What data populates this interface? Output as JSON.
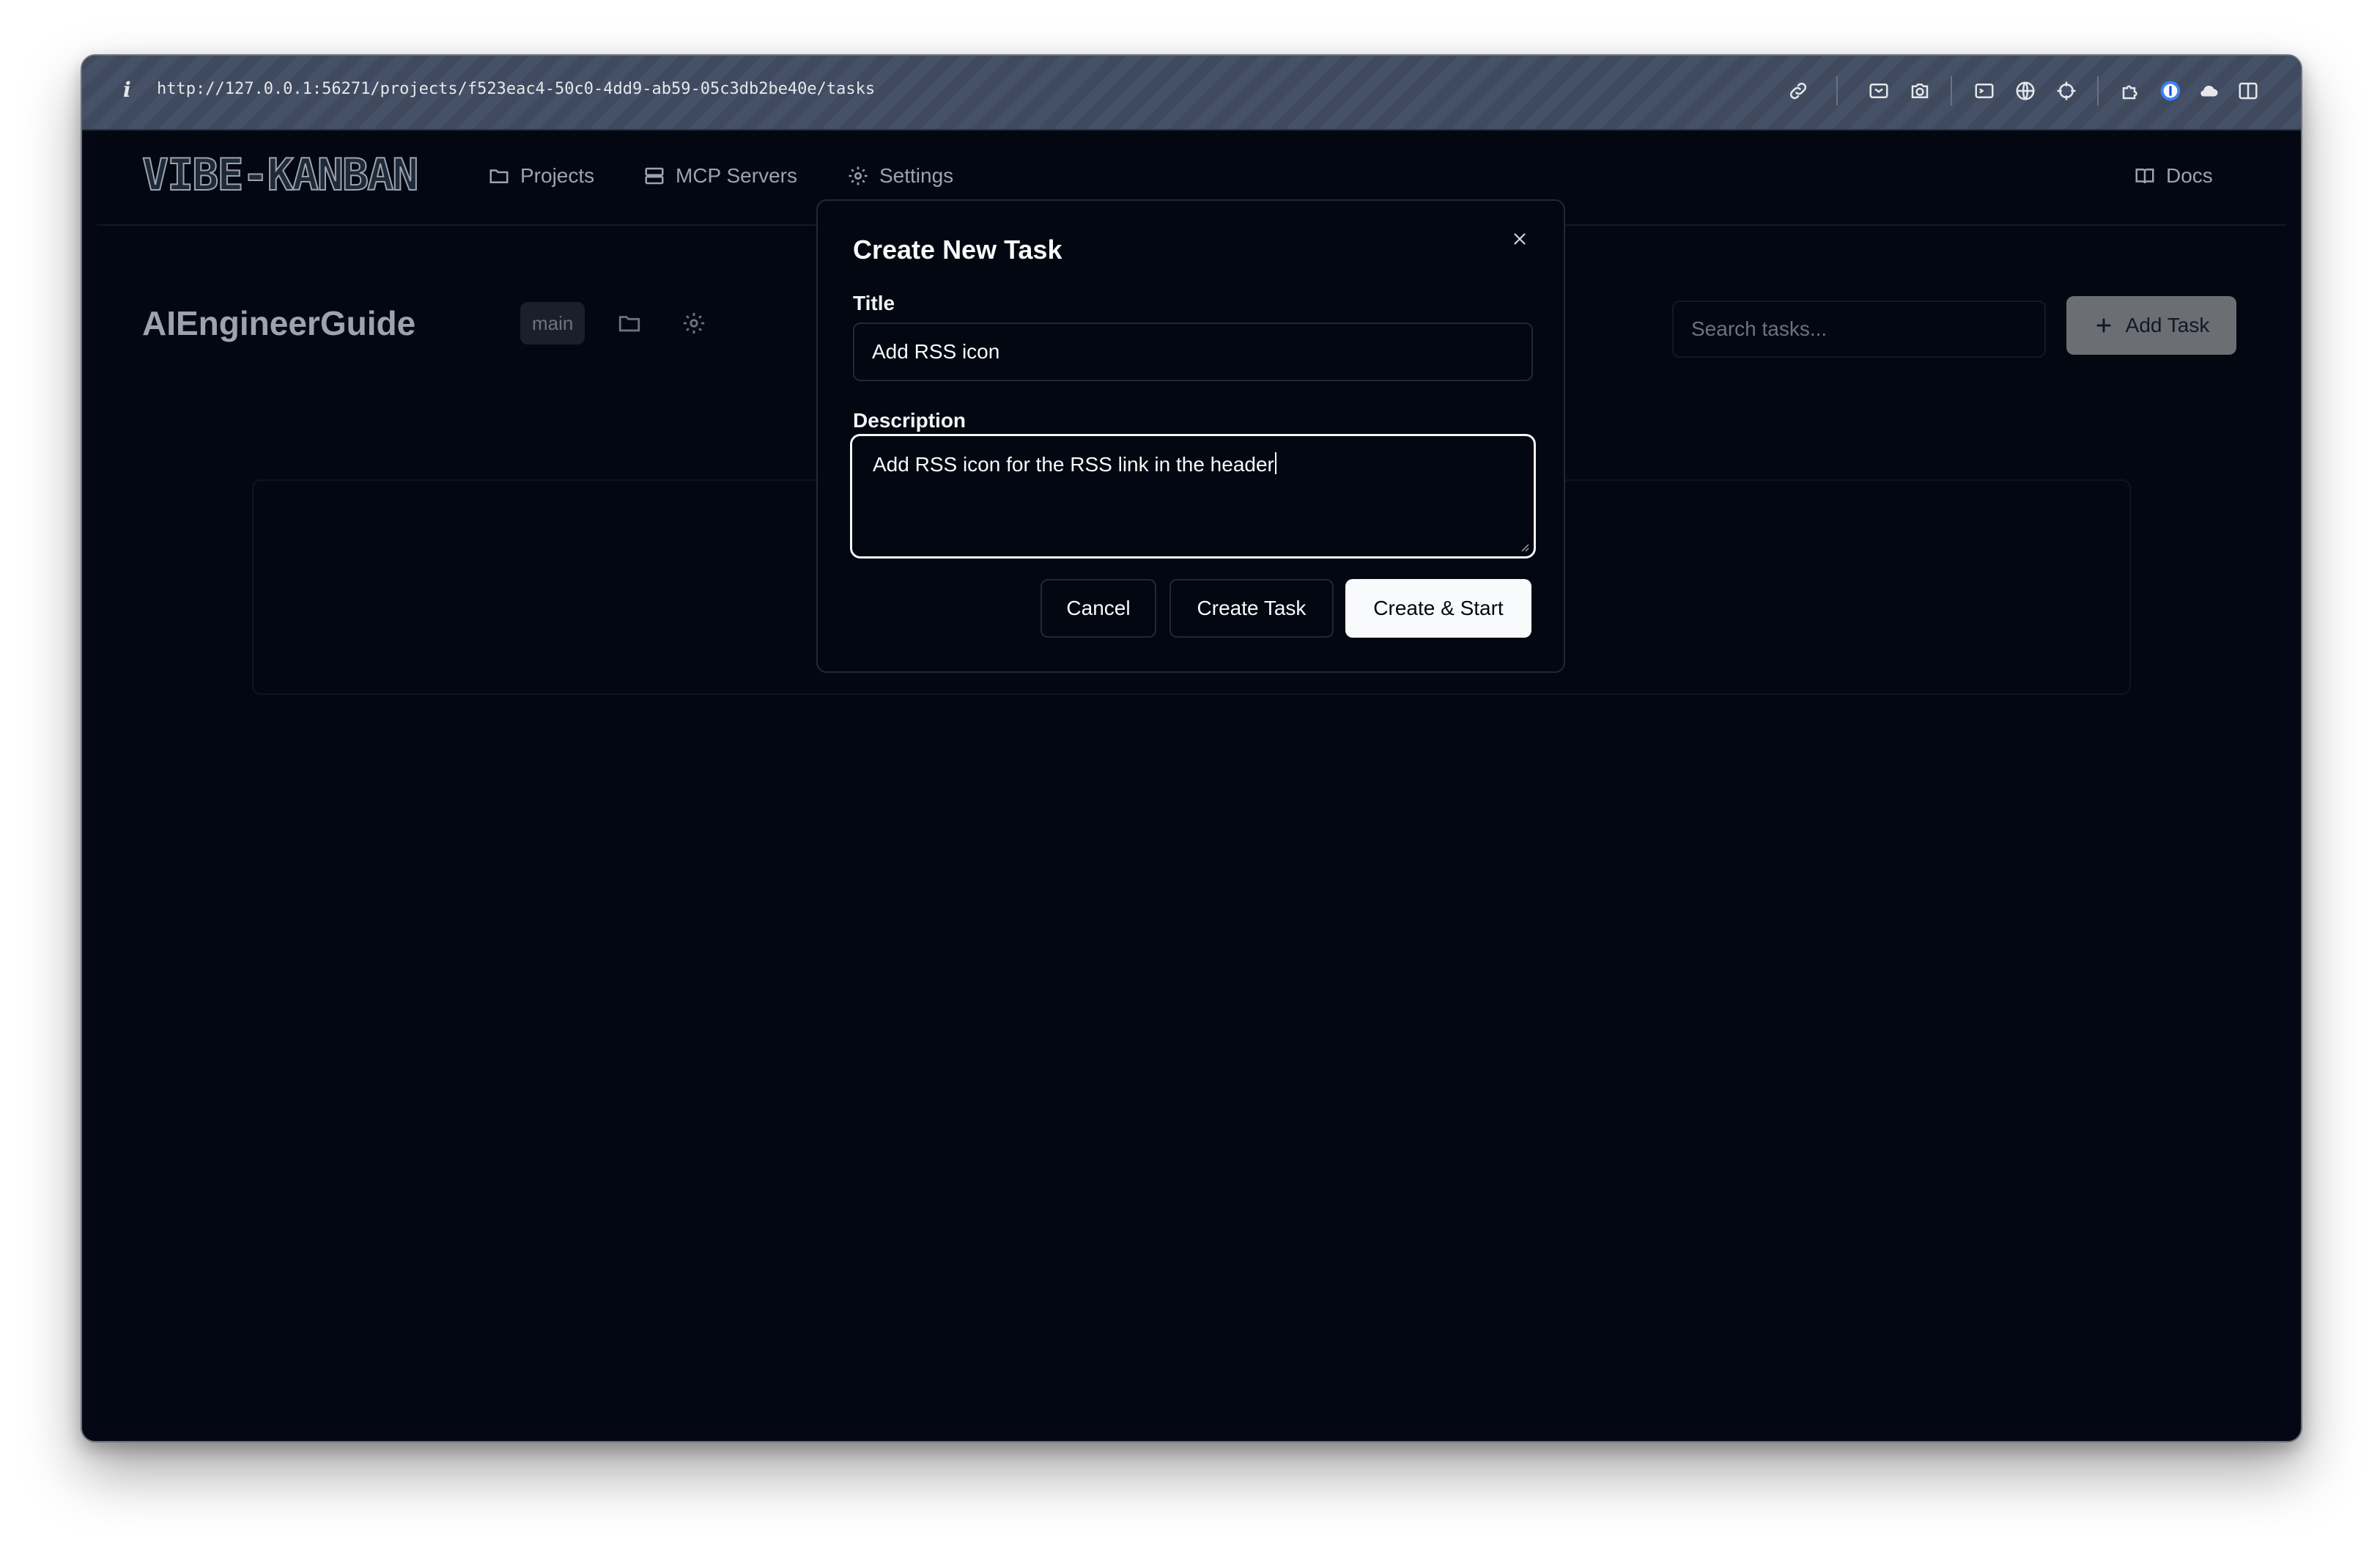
{
  "browser": {
    "info_symbol": "i",
    "url": "http://127.0.0.1:56271/projects/f523eac4-50c0-4dd9-ab59-05c3db2be40e/tasks",
    "toolbar_icons": [
      "link-icon",
      "media-icon",
      "camera-icon",
      "terminal-icon",
      "globe-icon",
      "crosshair-icon",
      "puzzle-icon",
      "password-manager-icon",
      "cloud-icon",
      "sidebar-icon"
    ]
  },
  "nav": {
    "logo": "VIBE-KANBAN",
    "projects": "Projects",
    "mcp_servers": "MCP Servers",
    "settings": "Settings",
    "docs": "Docs"
  },
  "project": {
    "name": "AIEngineerGuide",
    "branch": "main",
    "search_placeholder": "Search tasks...",
    "add_task": "Add Task"
  },
  "modal": {
    "title": "Create New Task",
    "title_label": "Title",
    "title_value": "Add RSS icon",
    "description_label": "Description",
    "description_value": "Add RSS icon for the RSS link in the header",
    "cancel": "Cancel",
    "create_task": "Create Task",
    "create_start": "Create & Start"
  }
}
